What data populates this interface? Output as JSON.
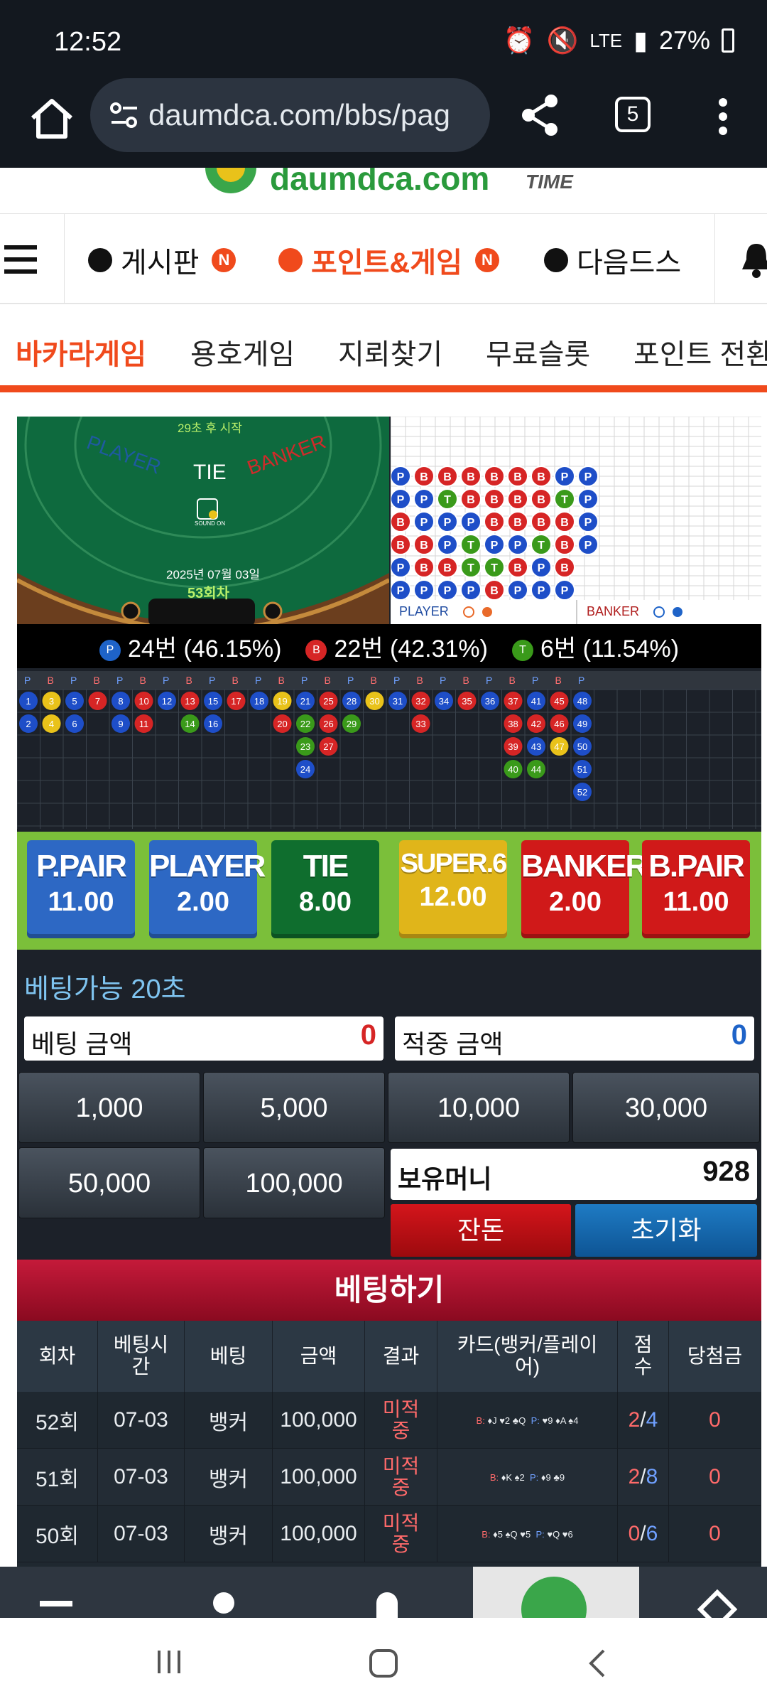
{
  "status": {
    "time": "12:52",
    "battery": "27%",
    "network": "LTE"
  },
  "browser": {
    "url": "daumdca.com/bbs/pag",
    "tab_count": "5"
  },
  "site": {
    "logo_text": "daumdca.com",
    "logo_sub": "TIME"
  },
  "category_nav": [
    {
      "label": "게시판",
      "dot_color": "#111111",
      "badge": "N",
      "active": false
    },
    {
      "label": "포인트&게임",
      "dot_color": "#f04a1c",
      "badge": "N",
      "active": true
    },
    {
      "label": "다음드스",
      "dot_color": "#111111",
      "badge": "",
      "active": false
    }
  ],
  "game_tabs": [
    "바카라게임",
    "용호게임",
    "지뢰찾기",
    "무료슬롯",
    "포인트 전환"
  ],
  "table": {
    "countdown": "29초 후 시작",
    "player": "PLAYER",
    "tie": "TIE",
    "banker": "BANKER",
    "sound": "SOUND ON",
    "date": "2025년 07월 03일",
    "round": "53회차"
  },
  "scoreboard": {
    "player_label": "PLAYER",
    "banker_label": "BANKER"
  },
  "stats": [
    {
      "mark": "P",
      "color": "#1e63c8",
      "text": "24번 (46.15%)"
    },
    {
      "mark": "B",
      "color": "#d62525",
      "text": "22번 (42.31%)"
    },
    {
      "mark": "T",
      "color": "#3a9a1a",
      "text": "6번 (11.54%)"
    }
  ],
  "road_header": [
    "P",
    "B",
    "P",
    "B",
    "P",
    "B",
    "P",
    "B",
    "P",
    "B",
    "P",
    "B",
    "P",
    "B",
    "P",
    "B",
    "P",
    "B",
    "P",
    "B",
    "P",
    "B",
    "P",
    "B",
    "P"
  ],
  "bets": [
    {
      "name": "P.PAIR",
      "odds": "11.00",
      "color": "#2d68c4"
    },
    {
      "name": "PLAYER",
      "odds": "2.00",
      "color": "#2d68c4"
    },
    {
      "name": "TIE",
      "odds": "8.00",
      "color": "#0f6e2e"
    },
    {
      "name": "SUPER.6",
      "odds": "12.00",
      "color": "#e0b51a"
    },
    {
      "name": "BANKER",
      "odds": "2.00",
      "color": "#d01919"
    },
    {
      "name": "B.PAIR",
      "odds": "11.00",
      "color": "#d01919"
    }
  ],
  "bet_info": {
    "available": "베팅가능 20초",
    "bet_amount_label": "베팅 금액",
    "bet_amount": "0",
    "win_amount_label": "적중 금액",
    "win_amount": "0"
  },
  "chips": [
    "1,000",
    "5,000",
    "10,000",
    "30,000",
    "50,000",
    "100,000"
  ],
  "balance": {
    "label": "보유머니",
    "value": "928",
    "change_label": "잔돈",
    "reset_label": "초기화"
  },
  "bet_button": "베팅하기",
  "history": {
    "headers": [
      "회차",
      "베팅시간",
      "베팅",
      "금액",
      "결과",
      "카드(뱅커/플레이어)",
      "점수",
      "당첨금"
    ],
    "rows": [
      {
        "round": "52회",
        "time": "07-03",
        "bet": "뱅커",
        "amount": "100,000",
        "result": "미적중",
        "cards_b": "♦J ♥2 ♣Q",
        "cards_p": "♥9 ♦A ♠4",
        "score_b": "2",
        "score_p": "4",
        "prize": "0"
      },
      {
        "round": "51회",
        "time": "07-03",
        "bet": "뱅커",
        "amount": "100,000",
        "result": "미적중",
        "cards_b": "♦K ♠2",
        "cards_p": "♦9 ♣9",
        "score_b": "2",
        "score_p": "8",
        "prize": "0"
      },
      {
        "round": "50회",
        "time": "07-03",
        "bet": "뱅커",
        "amount": "100,000",
        "result": "미적중",
        "cards_b": "♦5 ♠Q ♥5",
        "cards_p": "♥Q ♥6",
        "score_b": "0",
        "score_p": "6",
        "prize": "0"
      }
    ]
  }
}
